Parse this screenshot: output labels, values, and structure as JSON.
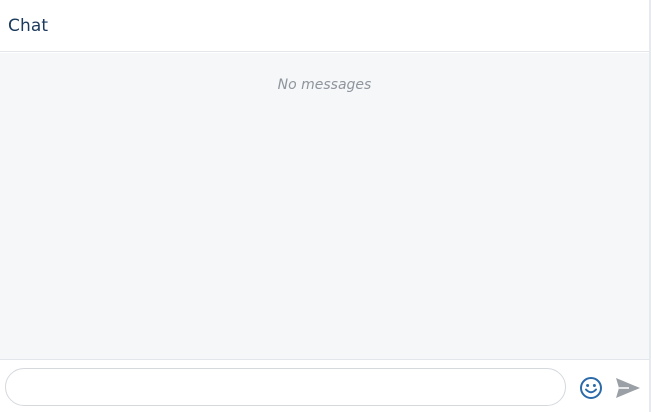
{
  "header": {
    "title": "Chat"
  },
  "messages": {
    "items": [],
    "empty_text": "No messages"
  },
  "composer": {
    "input_value": "",
    "input_placeholder": "",
    "emoji_icon": "smiley-icon",
    "send_icon": "send-arrow-icon"
  },
  "colors": {
    "title": "#1b3a5c",
    "emoji_icon": "#2b6aa8",
    "send_icon": "#9aa0a6",
    "messages_background": "#f6f7f9"
  }
}
